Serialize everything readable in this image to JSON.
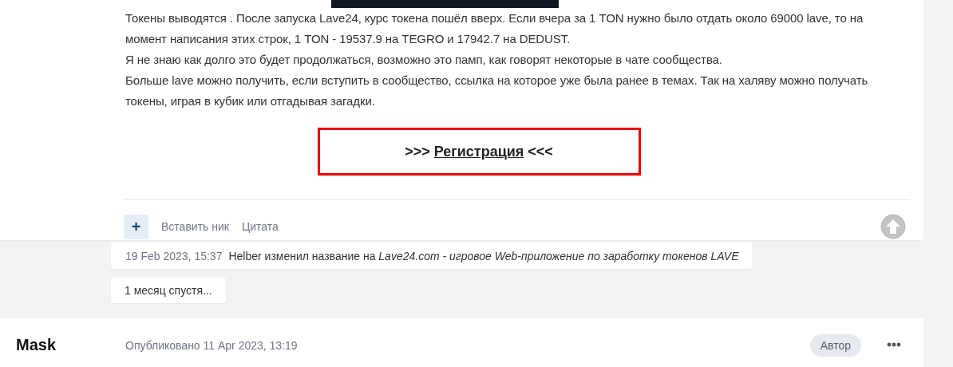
{
  "post": {
    "paragraphs": [
      "Токены выводятся . После запуска Lave24, курс токена пошёл вверх. Если вчера за 1 TON нужно было отдать около 69000 lave, то на момент написания этих строк, 1 TON - 19537.9 на TEGRO и 17942.7 на DEDUST.",
      "Я не знаю как долго это будет продолжаться, возможно это памп, как говорят некоторые в чате сообщества.",
      "Больше lave можно получить, если вступить в сообщество, ссылка на которое уже была ранее в темах. Так на халяву можно получать токены, играя в кубик или отгадывая загадки."
    ],
    "registration": {
      "prefix": ">>>",
      "link": "Регистрация",
      "suffix": "<<<"
    },
    "actions": [
      {
        "kind": "icon-button",
        "label": "+"
      },
      {
        "kind": "link",
        "label": "Вставить ник"
      },
      {
        "kind": "link",
        "label": "Цитата"
      }
    ]
  },
  "events": [
    {
      "kind": "rename",
      "time": "19 Feb 2023, 15:37",
      "text": "Helber изменил название на *Lave24.com - игровое Web-приложение по заработку токенов LAVE*"
    },
    {
      "kind": "gap",
      "text": "1 месяц спустя..."
    }
  ],
  "next_post": {
    "author": "Mask",
    "published": "Опубликовано 11 Apr 2023, 13:19",
    "badge": "Автор"
  }
}
